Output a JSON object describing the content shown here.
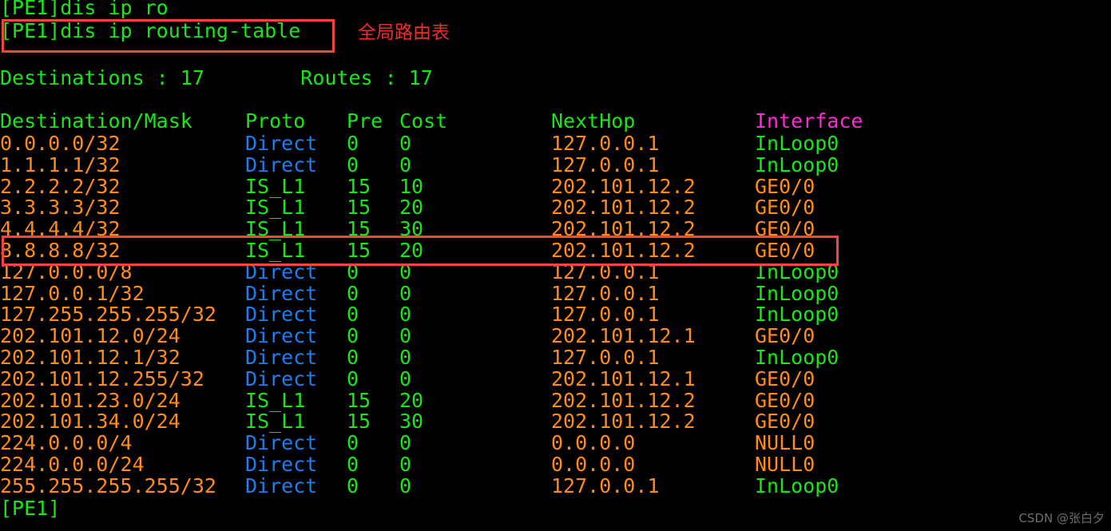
{
  "terminal": {
    "background": "#000000",
    "colors": {
      "green": "#19e619",
      "orange": "#ff8c1a",
      "blue": "#1a7ff2",
      "magenta": "#ff2ad4",
      "highlight_red": "#f5443f",
      "annotation_red": "#f02b2b"
    },
    "prompt_line_1": "[PE1]dis ip ro",
    "prompt_line_2": "[PE1]dis ip routing-table",
    "annotation": "全局路由表",
    "summary": "Destinations : 17        Routes : 17",
    "summary_parts": {
      "destinations_label": "Destinations : ",
      "destinations_value": "17",
      "routes_label": "Routes : ",
      "routes_value": "17"
    },
    "headers": {
      "destination": "Destination/Mask",
      "proto": "Proto",
      "pre": "Pre",
      "cost": "Cost",
      "nexthop": "NextHop",
      "interface": "Interface"
    },
    "rows": [
      {
        "dest": "0.0.0.0/32",
        "proto": "Direct",
        "pre": "0",
        "cost": "0",
        "nexthop": "127.0.0.1",
        "intf": "InLoop0",
        "intf_color": "green"
      },
      {
        "dest": "1.1.1.1/32",
        "proto": "Direct",
        "pre": "0",
        "cost": "0",
        "nexthop": "127.0.0.1",
        "intf": "InLoop0",
        "intf_color": "green"
      },
      {
        "dest": "2.2.2.2/32",
        "proto": "IS_L1",
        "pre": "15",
        "cost": "10",
        "nexthop": "202.101.12.2",
        "intf": "GE0/0",
        "intf_color": "orange"
      },
      {
        "dest": "3.3.3.3/32",
        "proto": "IS_L1",
        "pre": "15",
        "cost": "20",
        "nexthop": "202.101.12.2",
        "intf": "GE0/0",
        "intf_color": "orange"
      },
      {
        "dest": "4.4.4.4/32",
        "proto": "IS_L1",
        "pre": "15",
        "cost": "30",
        "nexthop": "202.101.12.2",
        "intf": "GE0/0",
        "intf_color": "orange"
      },
      {
        "dest": "8.8.8.8/32",
        "proto": "IS_L1",
        "pre": "15",
        "cost": "20",
        "nexthop": "202.101.12.2",
        "intf": "GE0/0",
        "intf_color": "orange"
      },
      {
        "dest": "127.0.0.0/8",
        "proto": "Direct",
        "pre": "0",
        "cost": "0",
        "nexthop": "127.0.0.1",
        "intf": "InLoop0",
        "intf_color": "green"
      },
      {
        "dest": "127.0.0.1/32",
        "proto": "Direct",
        "pre": "0",
        "cost": "0",
        "nexthop": "127.0.0.1",
        "intf": "InLoop0",
        "intf_color": "green"
      },
      {
        "dest": "127.255.255.255/32",
        "proto": "Direct",
        "pre": "0",
        "cost": "0",
        "nexthop": "127.0.0.1",
        "intf": "InLoop0",
        "intf_color": "green"
      },
      {
        "dest": "202.101.12.0/24",
        "proto": "Direct",
        "pre": "0",
        "cost": "0",
        "nexthop": "202.101.12.1",
        "intf": "GE0/0",
        "intf_color": "orange"
      },
      {
        "dest": "202.101.12.1/32",
        "proto": "Direct",
        "pre": "0",
        "cost": "0",
        "nexthop": "127.0.0.1",
        "intf": "InLoop0",
        "intf_color": "green"
      },
      {
        "dest": "202.101.12.255/32",
        "proto": "Direct",
        "pre": "0",
        "cost": "0",
        "nexthop": "202.101.12.1",
        "intf": "GE0/0",
        "intf_color": "orange"
      },
      {
        "dest": "202.101.23.0/24",
        "proto": "IS_L1",
        "pre": "15",
        "cost": "20",
        "nexthop": "202.101.12.2",
        "intf": "GE0/0",
        "intf_color": "orange"
      },
      {
        "dest": "202.101.34.0/24",
        "proto": "IS_L1",
        "pre": "15",
        "cost": "30",
        "nexthop": "202.101.12.2",
        "intf": "GE0/0",
        "intf_color": "orange"
      },
      {
        "dest": "224.0.0.0/4",
        "proto": "Direct",
        "pre": "0",
        "cost": "0",
        "nexthop": "0.0.0.0",
        "intf": "NULL0",
        "intf_color": "orange"
      },
      {
        "dest": "224.0.0.0/24",
        "proto": "Direct",
        "pre": "0",
        "cost": "0",
        "nexthop": "0.0.0.0",
        "intf": "NULL0",
        "intf_color": "orange"
      },
      {
        "dest": "255.255.255.255/32",
        "proto": "Direct",
        "pre": "0",
        "cost": "0",
        "nexthop": "127.0.0.1",
        "intf": "InLoop0",
        "intf_color": "green"
      }
    ],
    "trailing_prompt": "[PE1]"
  },
  "watermark": "CSDN @张白夕"
}
